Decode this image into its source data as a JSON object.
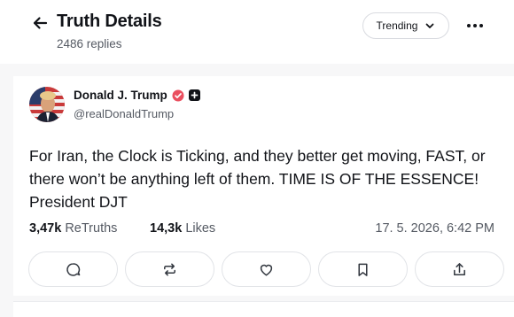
{
  "header": {
    "title": "Truth Details",
    "replies": "2486 replies",
    "sort_label": "Trending",
    "back_icon": "arrow-left-icon",
    "more_icon": "more-horizontal-icon"
  },
  "post": {
    "author_name": "Donald J. Trump",
    "handle": "@realDonaldTrump",
    "text": "For Iran, the Clock is Ticking, and they better get moving, FAST, or there won’t be anything left of them. TIME IS OF THE ESSENCE! President DJT",
    "retruths_count": "3,47k",
    "retruths_label": "ReTruths",
    "likes_count": "14,3k",
    "likes_label": "Likes",
    "timestamp": "17. 5. 2026, 6:42 PM"
  },
  "actions": [
    "reply-icon",
    "retruth-icon",
    "like-icon",
    "bookmark-icon",
    "share-icon"
  ],
  "colors": {
    "verified": "#ea4f5f",
    "text": "#111318",
    "muted": "#555a63",
    "border": "#e1e3e7",
    "background": "#f7f7f8"
  }
}
